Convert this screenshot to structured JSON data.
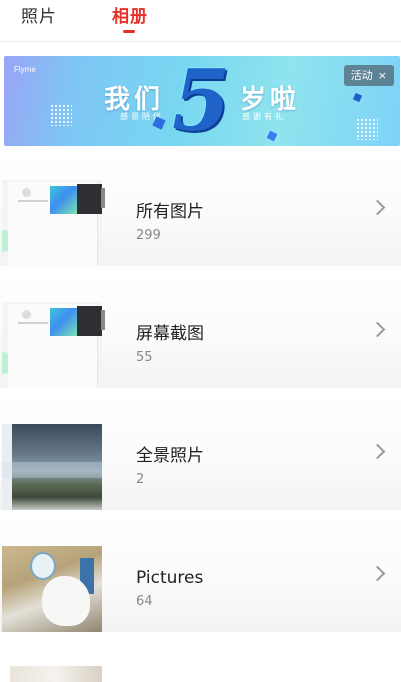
{
  "tabs": [
    {
      "label": "照片",
      "active": false
    },
    {
      "label": "相册",
      "active": true
    }
  ],
  "banner": {
    "brand": "Flyme",
    "title_left": "我们",
    "title_number": "5",
    "title_right": "岁啦",
    "subtitle_left": "感恩陪伴",
    "subtitle_right": "感谢有礼",
    "tag_label": "活动",
    "tag_close": "×"
  },
  "albums": [
    {
      "name": "所有图片",
      "count": "299",
      "thumb": "screenshot"
    },
    {
      "name": "屏幕截图",
      "count": "55",
      "thumb": "screenshot"
    },
    {
      "name": "全景照片",
      "count": "2",
      "thumb": "panorama"
    },
    {
      "name": "Pictures",
      "count": "64",
      "thumb": "photo"
    }
  ],
  "colors": {
    "accent": "#e6312a",
    "banner_start": "#9aa4f5",
    "banner_end": "#7fd2f7",
    "five": "#1f62c8"
  },
  "icons": {
    "album_arrow": "chevron-right-icon",
    "tag_close": "close-icon"
  }
}
